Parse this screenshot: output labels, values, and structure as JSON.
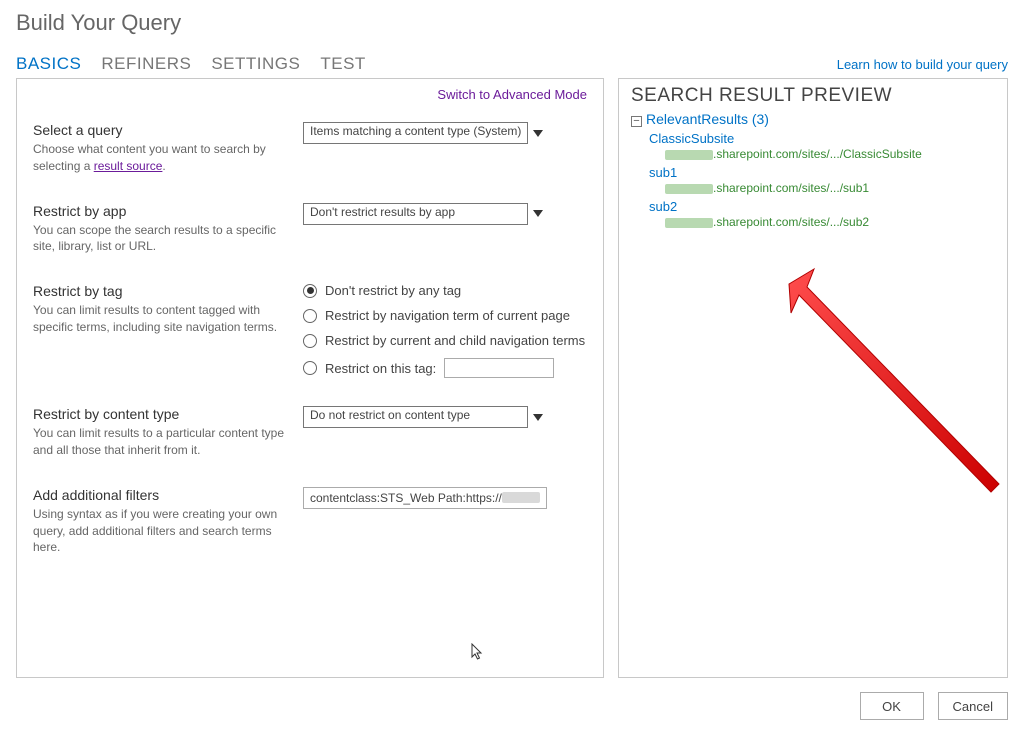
{
  "page": {
    "title": "Build Your Query"
  },
  "tabs": {
    "basics": "BASICS",
    "refiners": "REFINERS",
    "settings": "SETTINGS",
    "test": "TEST"
  },
  "learn_link": "Learn how to build your query",
  "switch_mode": "Switch to Advanced Mode",
  "select_query": {
    "title": "Select a query",
    "help_prefix": "Choose what content you want to search by selecting a ",
    "help_link": "result source",
    "help_suffix": ".",
    "value": "Items matching a content type (System)"
  },
  "restrict_app": {
    "title": "Restrict by app",
    "help": "You can scope the search results to a specific site, library, list or URL.",
    "value": "Don't restrict results by app"
  },
  "restrict_tag": {
    "title": "Restrict by tag",
    "help": "You can limit results to content tagged with specific terms, including site navigation terms.",
    "opt1": "Don't restrict by any tag",
    "opt2": "Restrict by navigation term of current page",
    "opt3": "Restrict by current and child navigation terms",
    "opt4": "Restrict on this tag:"
  },
  "restrict_ct": {
    "title": "Restrict by content type",
    "help": "You can limit results to a particular content type and all those that inherit from it.",
    "value": "Do not restrict on content type"
  },
  "add_filters": {
    "title": "Add additional filters",
    "help": "Using syntax as if you were creating your own query, add additional filters and search terms here.",
    "value_prefix": "contentclass:STS_Web Path:https://"
  },
  "preview": {
    "title": "SEARCH RESULT PREVIEW",
    "root_label": "RelevantResults (3)",
    "results": [
      {
        "title": "ClassicSubsite",
        "url_suffix": ".sharepoint.com/sites/.../ClassicSubsite"
      },
      {
        "title": "sub1",
        "url_suffix": ".sharepoint.com/sites/.../sub1"
      },
      {
        "title": "sub2",
        "url_suffix": ".sharepoint.com/sites/.../sub2"
      }
    ]
  },
  "buttons": {
    "ok": "OK",
    "cancel": "Cancel"
  }
}
